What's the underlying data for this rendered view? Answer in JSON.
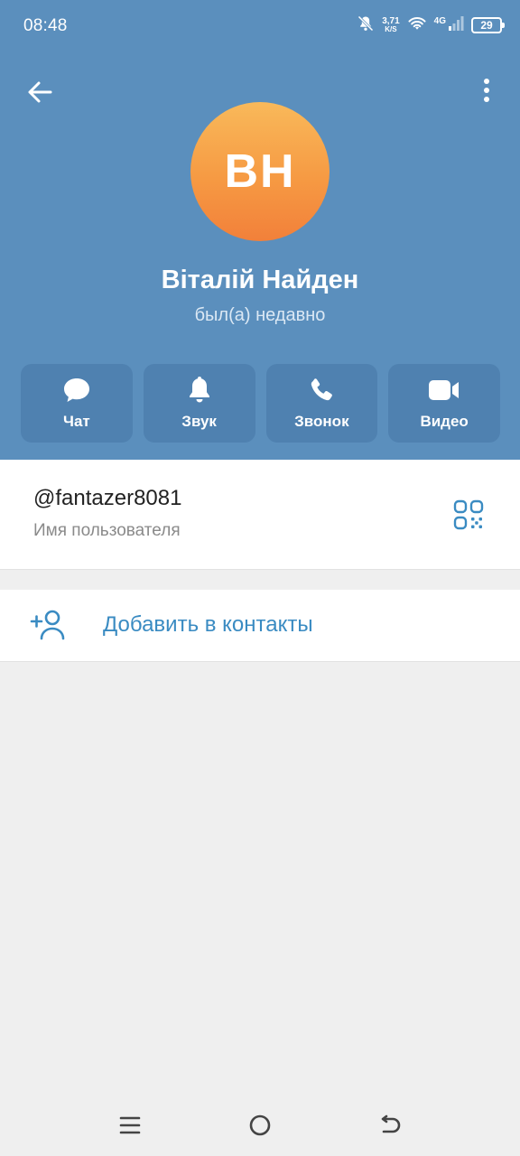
{
  "status_bar": {
    "time": "08:48",
    "net_speed_value": "3,71",
    "net_speed_unit": "K/S",
    "network_type": "4G",
    "battery_level": "29"
  },
  "profile": {
    "initials": "ВН",
    "name": "Віталій Найден",
    "last_seen": "был(а) недавно"
  },
  "actions": [
    {
      "label": "Чат",
      "icon": "chat-bubble-icon"
    },
    {
      "label": "Звук",
      "icon": "bell-icon"
    },
    {
      "label": "Звонок",
      "icon": "phone-icon"
    },
    {
      "label": "Видео",
      "icon": "video-camera-icon"
    }
  ],
  "username": {
    "value": "@fantazer8081",
    "label": "Имя пользователя"
  },
  "add_contact": {
    "label": "Добавить в контакты"
  },
  "colors": {
    "header_bg": "#5b8fbd",
    "action_bg": "#4f81b0",
    "avatar_top": "#f9b95a",
    "avatar_bottom": "#f2803a",
    "accent_link": "#3a8bc2",
    "page_bg": "#efefef"
  }
}
